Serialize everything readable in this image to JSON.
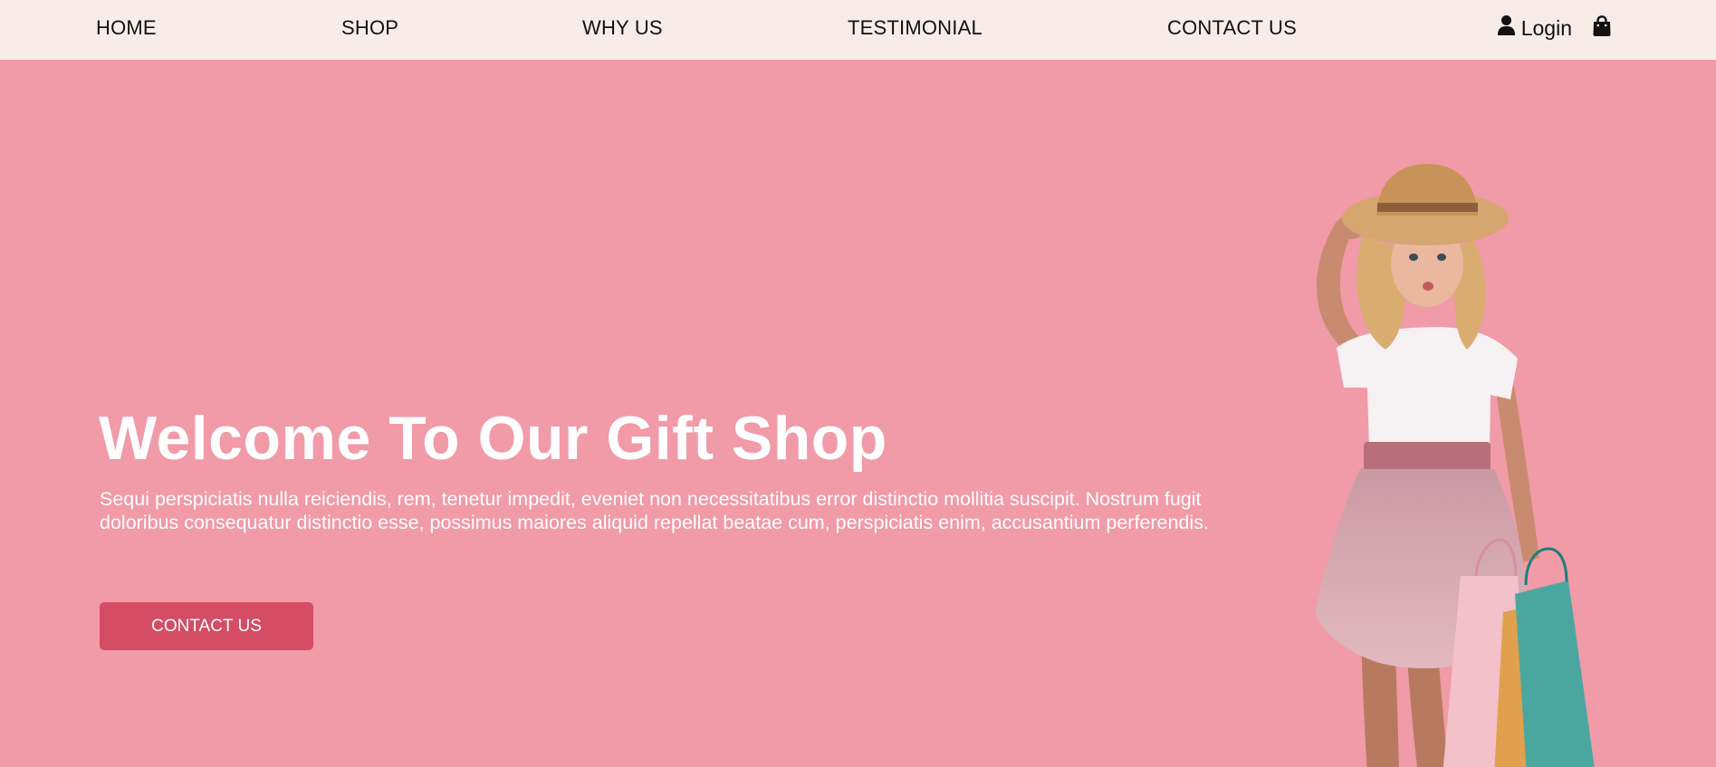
{
  "nav": {
    "links": [
      {
        "label": "HOME"
      },
      {
        "label": "SHOP"
      },
      {
        "label": "WHY US"
      },
      {
        "label": "TESTIMONIAL"
      },
      {
        "label": "CONTACT US"
      }
    ],
    "login_label": "Login",
    "icons": {
      "user": "user-icon",
      "cart": "shopping-bag-icon"
    }
  },
  "hero": {
    "title": "Welcome To Our Gift Shop",
    "paragraph": "Sequi perspiciatis nulla reiciendis, rem, tenetur impedit, eveniet non necessitatibus error distinctio mollitia suscipit. Nostrum fugit doloribus consequatur distinctio esse, possimus maiores aliquid repellat beatae cum, perspiciatis enim, accusantium perferendis.",
    "button_label": "CONTACT US",
    "image": "girl-with-shopping-bags"
  },
  "colors": {
    "nav_background": "#f8ece8",
    "hero_background": "#f19aa8",
    "button": "#d54c65",
    "text_light": "#ffffff",
    "text_dark": "#111111"
  }
}
